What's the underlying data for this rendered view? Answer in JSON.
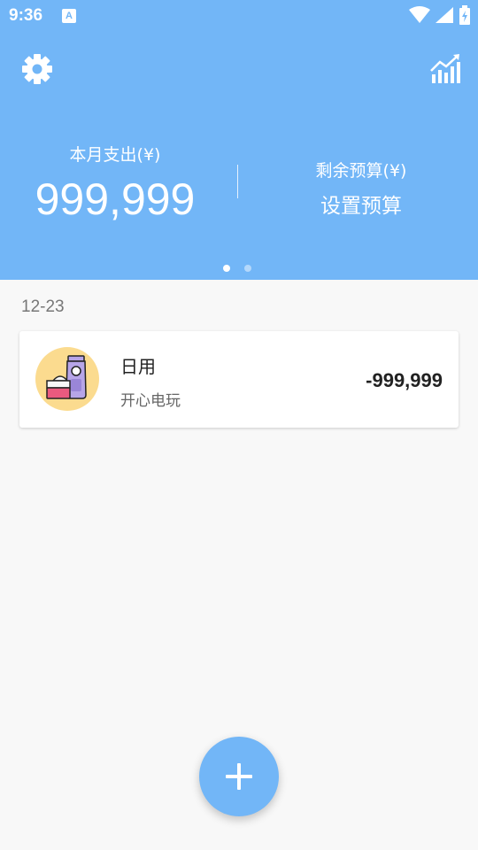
{
  "status_bar": {
    "time": "9:36",
    "notification_icon": "A",
    "icons": [
      "wifi-icon",
      "signal-icon",
      "battery-icon"
    ]
  },
  "header": {
    "settings_icon": "gear-icon",
    "stats_icon": "chart-icon",
    "spent_label": "本月支出(¥)",
    "spent_value": "999,999",
    "budget_label": "剩余预算(¥)",
    "budget_action": "设置预算",
    "page_indicator": {
      "pages": 2,
      "active": 1
    }
  },
  "records": [
    {
      "date": "12-23",
      "items": [
        {
          "category": "日用",
          "note": "开心电玩",
          "amount": "-999,999",
          "icon": "cosmetics-icon"
        }
      ]
    }
  ],
  "fab": {
    "icon": "plus-icon"
  },
  "colors": {
    "primary": "#72b6f7",
    "background": "#f8f8f8",
    "icon_bg": "#fbdb8f"
  }
}
